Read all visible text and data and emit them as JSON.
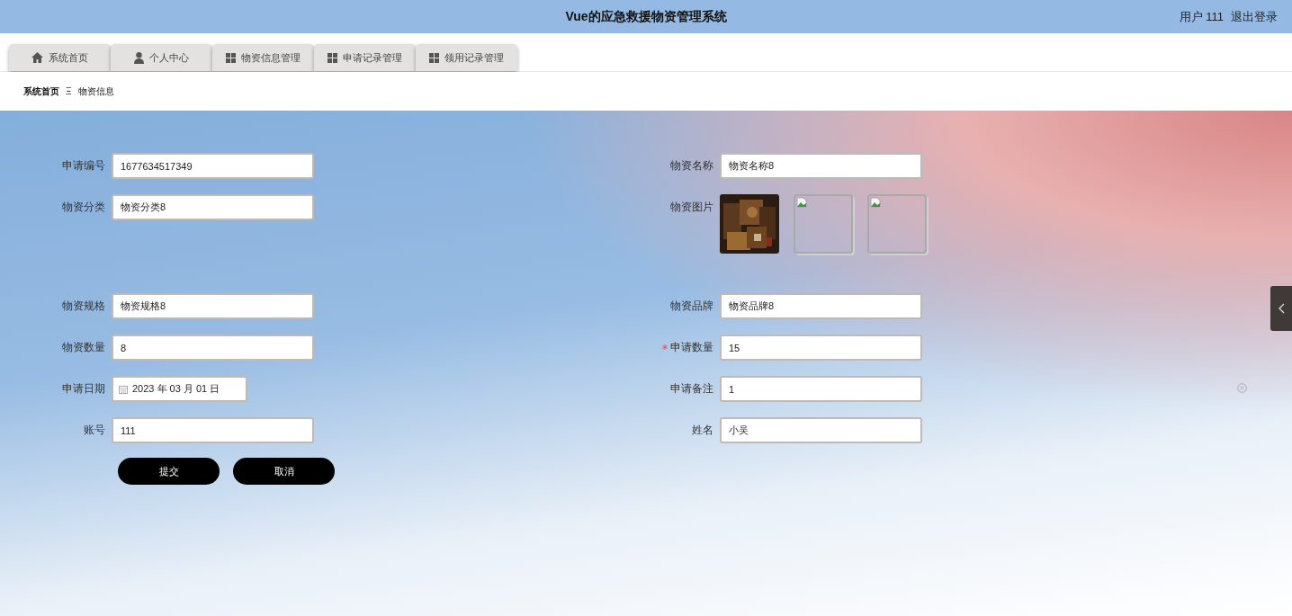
{
  "header": {
    "title": "Vue的应急救援物资管理系统",
    "user": "用户 111",
    "logout": "退出登录"
  },
  "nav_tabs": [
    {
      "label": "系统首页"
    },
    {
      "label": "个人中心"
    },
    {
      "label": "物资信息管理"
    },
    {
      "label": "申请记录管理"
    },
    {
      "label": "领用记录管理"
    }
  ],
  "breadcrumb": {
    "home": "系统首页",
    "separator": "Ξ",
    "current": "物资信息"
  },
  "form": {
    "rows": [
      {
        "left": {
          "kind": "text",
          "label": "申请编号",
          "value": "1677634517349",
          "required": false
        },
        "right": {
          "kind": "text",
          "label": "物资名称",
          "value": "物资名称8",
          "required": false
        }
      },
      {
        "left": {
          "kind": "text",
          "label": "物资分类",
          "value": "物资分类8",
          "required": false
        },
        "right": {
          "kind": "images",
          "label": "物资图片",
          "images": [
            {
              "kind": "picture"
            },
            {
              "kind": "broken"
            },
            {
              "kind": "broken"
            }
          ],
          "required": false
        }
      },
      {
        "left": {
          "kind": "text",
          "label": "物资规格",
          "value": "物资规格8",
          "required": false
        },
        "right": {
          "kind": "text",
          "label": "物资品牌",
          "value": "物资品牌8",
          "required": false
        }
      },
      {
        "left": {
          "kind": "text",
          "label": "物资数量",
          "value": "8",
          "required": false
        },
        "right": {
          "kind": "text",
          "label": "申请数量",
          "value": "15",
          "required": true
        }
      },
      {
        "left": {
          "kind": "date",
          "label": "申请日期",
          "value": "2023 年 03 月 01 日",
          "required": false
        },
        "right": {
          "kind": "text",
          "label": "申请备注",
          "value": "1",
          "required": false,
          "clearable": true
        }
      },
      {
        "left": {
          "kind": "text",
          "label": "账号",
          "value": "111",
          "required": false
        },
        "right": {
          "kind": "text",
          "label": "姓名",
          "value": "小吴",
          "required": false
        }
      }
    ],
    "buttons": [
      "提交",
      "取消"
    ]
  }
}
